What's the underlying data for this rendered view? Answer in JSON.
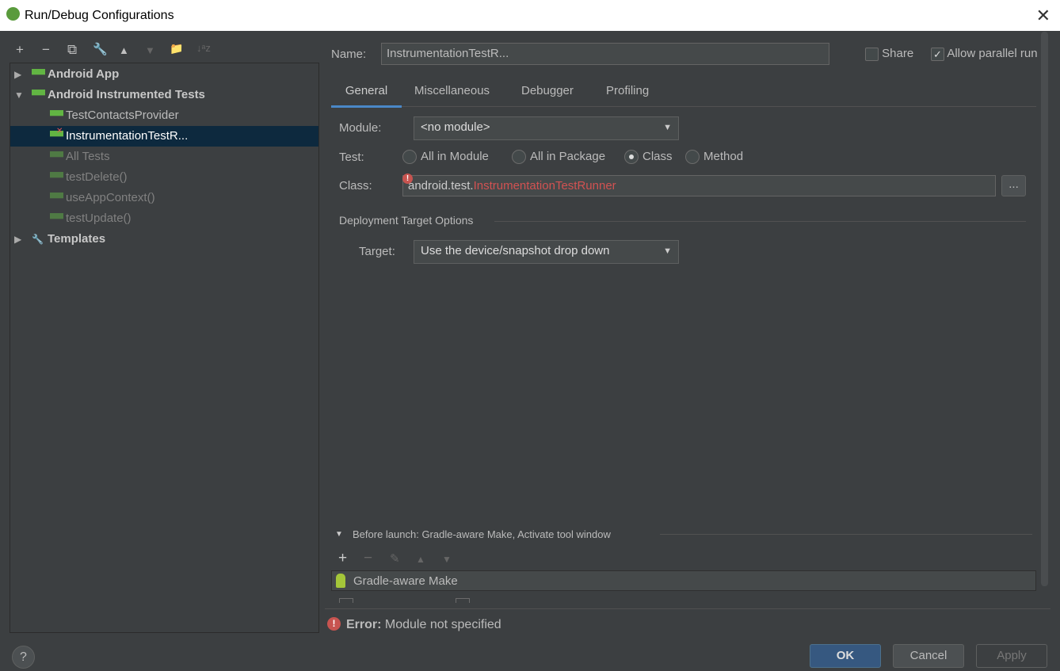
{
  "window": {
    "title": "Run/Debug Configurations"
  },
  "toolbar": {
    "add": "+",
    "remove": "−",
    "copy": "⧉",
    "edit": "🔧",
    "up": "▲",
    "down": "▼",
    "folder": "📁",
    "sort": "↓ᵃz"
  },
  "tree": {
    "items": [
      {
        "label": "Android App",
        "level": 0,
        "expanded": false,
        "icon": "android-icon"
      },
      {
        "label": "Android Instrumented Tests",
        "level": 0,
        "expanded": true,
        "icon": "android-test-icon"
      },
      {
        "label": "TestContactsProvider",
        "level": 1,
        "icon": "android-test-icon"
      },
      {
        "label": "InstrumentationTestR...",
        "level": 1,
        "icon": "android-test-error-icon",
        "selected": true
      },
      {
        "label": "All Tests",
        "level": 1,
        "icon": "android-test-icon",
        "temporary": true
      },
      {
        "label": "testDelete()",
        "level": 1,
        "icon": "android-test-icon",
        "temporary": true
      },
      {
        "label": "useAppContext()",
        "level": 1,
        "icon": "android-test-icon",
        "temporary": true
      },
      {
        "label": "testUpdate()",
        "level": 1,
        "icon": "android-test-icon",
        "temporary": true
      },
      {
        "label": "Templates",
        "level": 0,
        "expanded": false,
        "icon": "wrench-icon"
      }
    ]
  },
  "header": {
    "name_label": "Name:",
    "name_value": "InstrumentationTestR...",
    "share_label": "Share",
    "share_checked": false,
    "parallel_label": "Allow parallel run",
    "parallel_checked": true
  },
  "tabs": [
    {
      "label": "General",
      "active": true
    },
    {
      "label": "Miscellaneous"
    },
    {
      "label": "Debugger"
    },
    {
      "label": "Profiling"
    }
  ],
  "general": {
    "module_label": "Module:",
    "module_value": "<no module>",
    "test_label": "Test:",
    "test_options": [
      "All in Module",
      "All in Package",
      "Class",
      "Method"
    ],
    "test_selected": "Class",
    "class_label": "Class:",
    "class_prefix": "android.test.",
    "class_name": "InstrumentationTestRunner",
    "browse": "...",
    "deployment_title": "Deployment Target Options",
    "target_label": "Target:",
    "target_value": "Use the device/snapshot drop down"
  },
  "before_launch": {
    "title": "Before launch: Gradle-aware Make, Activate tool window",
    "items": [
      "Gradle-aware Make"
    ]
  },
  "error": {
    "prefix": "Error:",
    "message": "Module not specified"
  },
  "buttons": {
    "help": "?",
    "ok": "OK",
    "cancel": "Cancel",
    "apply": "Apply"
  },
  "colors": {
    "accent": "#365880",
    "error": "#c75450",
    "selection": "#0d293e",
    "android": "#62b543"
  }
}
